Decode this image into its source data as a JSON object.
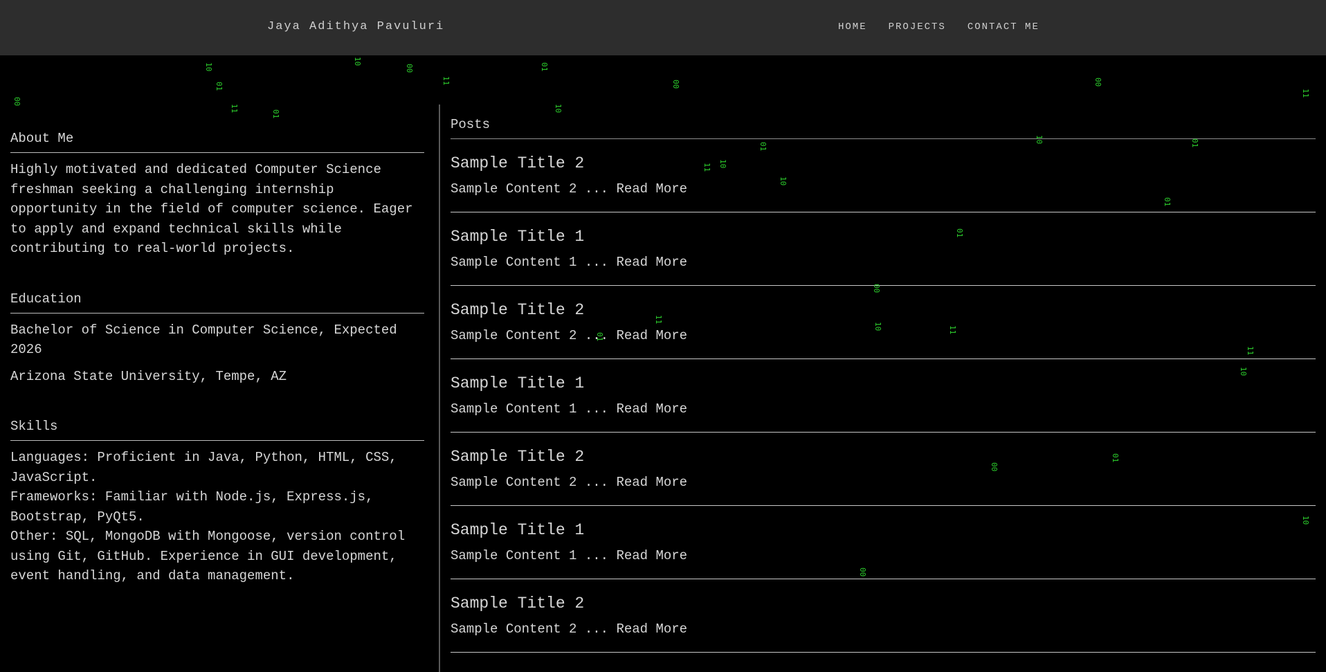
{
  "navbar": {
    "brand": "Jaya Adithya Pavuluri",
    "links": [
      "HOME",
      "PROJECTS",
      "CONTACT ME"
    ]
  },
  "about": {
    "heading": "About Me",
    "text": "Highly motivated and dedicated Computer Science freshman seeking a challenging internship opportunity in the field of computer science. Eager to apply and expand technical skills while contributing to real-world projects."
  },
  "education": {
    "heading": "Education",
    "degree": "Bachelor of Science in Computer Science, Expected 2026",
    "school": "Arizona State University, Tempe, AZ"
  },
  "skills": {
    "heading": "Skills",
    "languages": "Languages: Proficient in Java, Python, HTML, CSS, JavaScript.",
    "frameworks": "Frameworks: Familiar with Node.js, Express.js, Bootstrap, PyQt5.",
    "other": "Other: SQL, MongoDB with Mongoose, version control using Git, GitHub. Experience in GUI development, event handling, and data management."
  },
  "posts": {
    "heading": "Posts",
    "read_more": "Read More",
    "items": [
      {
        "title": "Sample Title 2",
        "content": "Sample Content 2 ..."
      },
      {
        "title": "Sample Title 1",
        "content": "Sample Content 1 ..."
      },
      {
        "title": "Sample Title 2",
        "content": "Sample Content 2 ..."
      },
      {
        "title": "Sample Title 1",
        "content": "Sample Content 1 ..."
      },
      {
        "title": "Sample Title 2",
        "content": "Sample Content 2 ..."
      },
      {
        "title": "Sample Title 1",
        "content": "Sample Content 1 ..."
      },
      {
        "title": "Sample Title 2",
        "content": "Sample Content 2 ..."
      }
    ]
  },
  "rain": [
    "00",
    "10",
    "01",
    "11",
    "01",
    "10",
    "00",
    "11",
    "01",
    "10",
    "00",
    "11",
    "10",
    "01",
    "10",
    "00",
    "11",
    "01",
    "10",
    "00",
    "01",
    "11",
    "10",
    "00",
    "01",
    "10",
    "11",
    "01",
    "00",
    "10",
    "11",
    "01"
  ],
  "colors": {
    "background": "#000000",
    "navbar": "#2d2d2d",
    "matrix_green": "#32e632"
  }
}
